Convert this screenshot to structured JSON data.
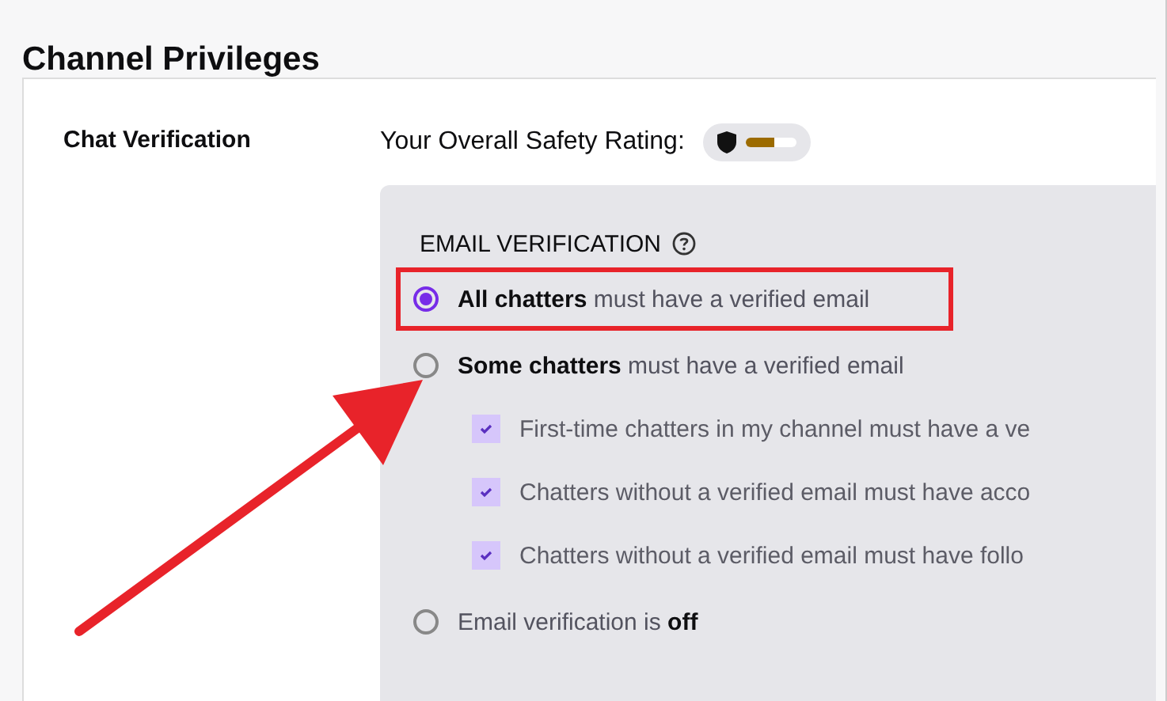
{
  "page_title": "Channel Privileges",
  "section": {
    "label": "Chat Verification",
    "safety_rating": {
      "label": "Your Overall Safety Rating:",
      "level": 0.55
    },
    "email_verification": {
      "heading": "EMAIL VERIFICATION",
      "options": [
        {
          "kind": "radio",
          "text": "**All chatters** must have a verified email",
          "selected": true,
          "highlighted": true
        },
        {
          "kind": "radio",
          "text": "**Some chatters** must have a verified email",
          "selected": false,
          "highlighted": false,
          "children": [
            {
              "kind": "checkbox",
              "text": "First-time chatters in my channel must have a ve",
              "checked": true
            },
            {
              "kind": "checkbox",
              "text": "Chatters without a verified email must have acco",
              "checked": true
            },
            {
              "kind": "checkbox",
              "text": "Chatters without a verified email must have follo",
              "checked": true
            }
          ]
        },
        {
          "kind": "radio",
          "text": "Email verification is **off**",
          "selected": false,
          "highlighted": false
        }
      ]
    }
  }
}
